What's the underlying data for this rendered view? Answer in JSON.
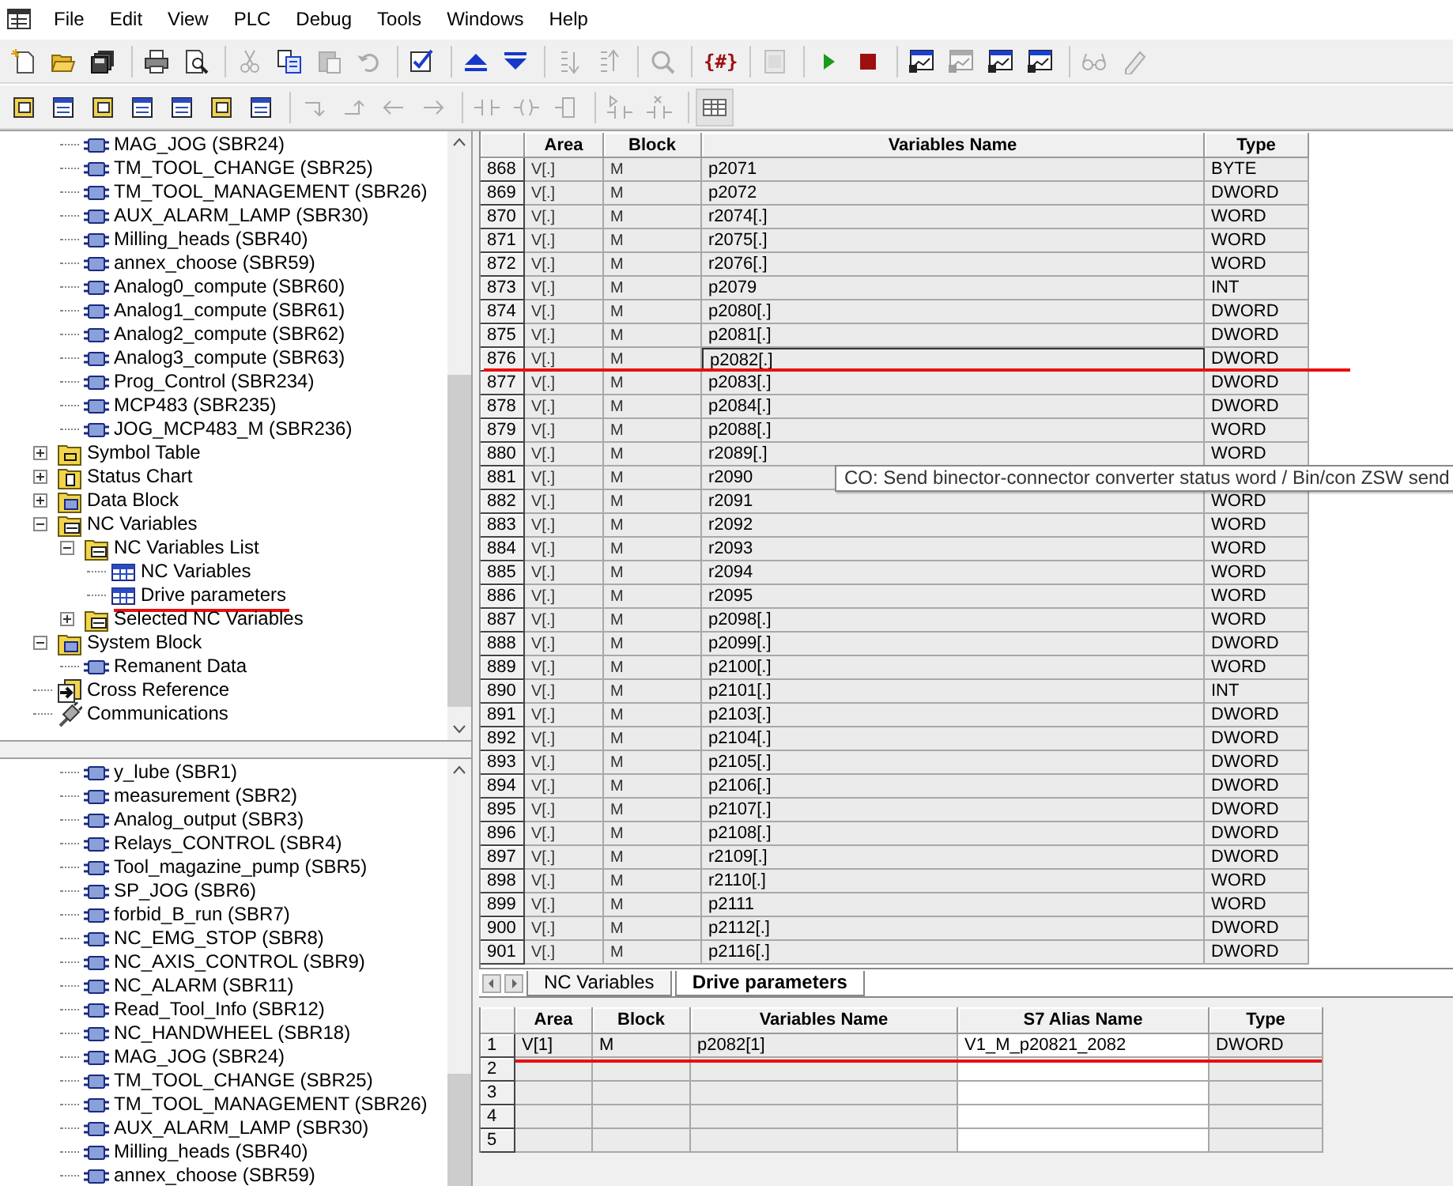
{
  "menu": [
    "File",
    "Edit",
    "View",
    "PLC",
    "Debug",
    "Tools",
    "Windows",
    "Help"
  ],
  "toolbar_1": [
    {
      "kind": "new",
      "disabled": false
    },
    {
      "kind": "open",
      "disabled": false
    },
    {
      "kind": "save-all",
      "disabled": false
    },
    {
      "kind": "separator"
    },
    {
      "kind": "print",
      "disabled": false
    },
    {
      "kind": "preview",
      "disabled": false
    },
    {
      "kind": "separator"
    },
    {
      "kind": "cut",
      "disabled": true
    },
    {
      "kind": "copy",
      "disabled": false
    },
    {
      "kind": "paste",
      "disabled": true
    },
    {
      "kind": "undo",
      "disabled": true
    },
    {
      "kind": "separator"
    },
    {
      "kind": "compile",
      "disabled": false
    },
    {
      "kind": "separator"
    },
    {
      "kind": "upload",
      "disabled": false
    },
    {
      "kind": "download",
      "disabled": false
    },
    {
      "kind": "separator"
    },
    {
      "kind": "sort-up",
      "disabled": true
    },
    {
      "kind": "sort-down",
      "disabled": true
    },
    {
      "kind": "separator"
    },
    {
      "kind": "find",
      "disabled": true
    },
    {
      "kind": "separator"
    },
    {
      "kind": "symbols",
      "text": "{#}",
      "disabled": false
    },
    {
      "kind": "separator"
    },
    {
      "kind": "window",
      "disabled": true
    },
    {
      "kind": "separator"
    },
    {
      "kind": "run",
      "disabled": false
    },
    {
      "kind": "stop",
      "disabled": false
    },
    {
      "kind": "separator"
    },
    {
      "kind": "monitor",
      "disabled": false
    },
    {
      "kind": "monitor",
      "disabled": true
    },
    {
      "kind": "monitor",
      "disabled": false
    },
    {
      "kind": "monitor",
      "disabled": false
    },
    {
      "kind": "separator"
    },
    {
      "kind": "glasses",
      "disabled": true
    },
    {
      "kind": "pen",
      "disabled": true
    }
  ],
  "toolbar_2": [
    {
      "kind": "doc-yellow",
      "disabled": false,
      "pressed": false
    },
    {
      "kind": "doc-blue",
      "disabled": false,
      "pressed": false
    },
    {
      "kind": "doc-yellow",
      "disabled": false,
      "pressed": false
    },
    {
      "kind": "doc-blue",
      "disabled": false,
      "pressed": false
    },
    {
      "kind": "doc-blue",
      "disabled": false,
      "pressed": false
    },
    {
      "kind": "doc-yellow",
      "disabled": false,
      "pressed": false
    },
    {
      "kind": "doc-blue",
      "disabled": false,
      "pressed": false
    },
    {
      "kind": "separator"
    },
    {
      "kind": "arrow-down-right",
      "disabled": true,
      "pressed": false
    },
    {
      "kind": "arrow-up-right",
      "disabled": true,
      "pressed": false
    },
    {
      "kind": "arrow-left",
      "disabled": true,
      "pressed": false
    },
    {
      "kind": "arrow-right",
      "disabled": true,
      "pressed": false
    },
    {
      "kind": "separator"
    },
    {
      "kind": "contact",
      "disabled": true,
      "pressed": false
    },
    {
      "kind": "coil",
      "disabled": true,
      "pressed": false
    },
    {
      "kind": "box",
      "disabled": true,
      "pressed": false
    },
    {
      "kind": "separator"
    },
    {
      "kind": "contact-arrow",
      "disabled": true,
      "pressed": false
    },
    {
      "kind": "contact-x",
      "disabled": true,
      "pressed": false
    },
    {
      "kind": "separator"
    },
    {
      "kind": "grid",
      "disabled": false,
      "pressed": true
    }
  ],
  "top_tree": {
    "scrolled_children": [
      "MAG_JOG (SBR24)",
      "TM_TOOL_CHANGE (SBR25)",
      "TM_TOOL_MANAGEMENT (SBR26)",
      "AUX_ALARM_LAMP (SBR30)",
      "Milling_heads (SBR40)",
      "annex_choose (SBR59)",
      "Analog0_compute (SBR60)",
      "Analog1_compute (SBR61)",
      "Analog2_compute (SBR62)",
      "Analog3_compute (SBR63)",
      "Prog_Control (SBR234)",
      "MCP483 (SBR235)",
      "JOG_MCP483_M (SBR236)"
    ],
    "nodes": [
      {
        "label": "Symbol Table",
        "kind": "symbol-table",
        "expanded": false
      },
      {
        "label": "Status Chart",
        "kind": "status-chart",
        "expanded": false
      },
      {
        "label": "Data Block",
        "kind": "data-block",
        "expanded": false
      },
      {
        "label": "NC Variables",
        "kind": "nc-variables",
        "expanded": true,
        "children": [
          {
            "label": "NC Variables List",
            "kind": "nc-variables",
            "expanded": true,
            "children": [
              {
                "label": "NC Variables",
                "kind": "table",
                "underlined": false
              },
              {
                "label": "Drive parameters",
                "kind": "table",
                "underlined": true
              }
            ]
          },
          {
            "label": "Selected NC Variables",
            "kind": "nc-variables",
            "expanded": false
          }
        ]
      },
      {
        "label": "System Block",
        "kind": "data-block",
        "expanded": true,
        "children": [
          {
            "label": "Remanent Data",
            "kind": "subroutine"
          }
        ]
      },
      {
        "label": "Cross Reference",
        "kind": "cross-reference"
      },
      {
        "label": "Communications",
        "kind": "communications"
      }
    ]
  },
  "bottom_tree": {
    "scrolled_children": [
      "y_lube (SBR1)",
      "measurement (SBR2)",
      "Analog_output (SBR3)",
      "Relays_CONTROL (SBR4)",
      "Tool_magazine_pump (SBR5)",
      "SP_JOG (SBR6)",
      "forbid_B_run (SBR7)",
      "NC_EMG_STOP (SBR8)",
      "NC_AXIS_CONTROL (SBR9)",
      "NC_ALARM (SBR11)",
      "Read_Tool_Info (SBR12)",
      "NC_HANDWHEEL (SBR18)",
      "MAG_JOG (SBR24)",
      "TM_TOOL_CHANGE (SBR25)",
      "TM_TOOL_MANAGEMENT (SBR26)",
      "AUX_ALARM_LAMP (SBR30)",
      "Milling_heads (SBR40)",
      "annex_choose (SBR59)"
    ]
  },
  "table": {
    "columns": [
      "Area",
      "Block",
      "Variables Name",
      "Type"
    ],
    "rows": [
      {
        "number": "868",
        "cells": [
          "V[.]",
          "M",
          "p2071",
          "BYTE"
        ],
        "focused": false,
        "underlined": false
      },
      {
        "number": "869",
        "cells": [
          "V[.]",
          "M",
          "p2072",
          "DWORD"
        ],
        "focused": false,
        "underlined": false
      },
      {
        "number": "870",
        "cells": [
          "V[.]",
          "M",
          "r2074[.]",
          "WORD"
        ],
        "focused": false,
        "underlined": false
      },
      {
        "number": "871",
        "cells": [
          "V[.]",
          "M",
          "r2075[.]",
          "WORD"
        ],
        "focused": false,
        "underlined": false
      },
      {
        "number": "872",
        "cells": [
          "V[.]",
          "M",
          "r2076[.]",
          "WORD"
        ],
        "focused": false,
        "underlined": false
      },
      {
        "number": "873",
        "cells": [
          "V[.]",
          "M",
          "p2079",
          "INT"
        ],
        "focused": false,
        "underlined": false
      },
      {
        "number": "874",
        "cells": [
          "V[.]",
          "M",
          "p2080[.]",
          "DWORD"
        ],
        "focused": false,
        "underlined": false
      },
      {
        "number": "875",
        "cells": [
          "V[.]",
          "M",
          "p2081[.]",
          "DWORD"
        ],
        "focused": false,
        "underlined": false
      },
      {
        "number": "876",
        "cells": [
          "V[.]",
          "M",
          "p2082[.]",
          "DWORD"
        ],
        "focused": true,
        "underlined": true
      },
      {
        "number": "877",
        "cells": [
          "V[.]",
          "M",
          "p2083[.]",
          "DWORD"
        ],
        "focused": false,
        "underlined": false
      },
      {
        "number": "878",
        "cells": [
          "V[.]",
          "M",
          "p2084[.]",
          "DWORD"
        ],
        "focused": false,
        "underlined": false
      },
      {
        "number": "879",
        "cells": [
          "V[.]",
          "M",
          "p2088[.]",
          "WORD"
        ],
        "focused": false,
        "underlined": false
      },
      {
        "number": "880",
        "cells": [
          "V[.]",
          "M",
          "r2089[.]",
          "WORD"
        ],
        "focused": false,
        "underlined": false
      },
      {
        "number": "881",
        "cells": [
          "V[.]",
          "M",
          "r2090",
          null
        ],
        "focused": false,
        "underlined": false
      },
      {
        "number": "882",
        "cells": [
          "V[.]",
          "M",
          "r2091",
          "WORD"
        ],
        "focused": false,
        "underlined": false
      },
      {
        "number": "883",
        "cells": [
          "V[.]",
          "M",
          "r2092",
          "WORD"
        ],
        "focused": false,
        "underlined": false
      },
      {
        "number": "884",
        "cells": [
          "V[.]",
          "M",
          "r2093",
          "WORD"
        ],
        "focused": false,
        "underlined": false
      },
      {
        "number": "885",
        "cells": [
          "V[.]",
          "M",
          "r2094",
          "WORD"
        ],
        "focused": false,
        "underlined": false
      },
      {
        "number": "886",
        "cells": [
          "V[.]",
          "M",
          "r2095",
          "WORD"
        ],
        "focused": false,
        "underlined": false
      },
      {
        "number": "887",
        "cells": [
          "V[.]",
          "M",
          "p2098[.]",
          "WORD"
        ],
        "focused": false,
        "underlined": false
      },
      {
        "number": "888",
        "cells": [
          "V[.]",
          "M",
          "p2099[.]",
          "DWORD"
        ],
        "focused": false,
        "underlined": false
      },
      {
        "number": "889",
        "cells": [
          "V[.]",
          "M",
          "p2100[.]",
          "WORD"
        ],
        "focused": false,
        "underlined": false
      },
      {
        "number": "890",
        "cells": [
          "V[.]",
          "M",
          "p2101[.]",
          "INT"
        ],
        "focused": false,
        "underlined": false
      },
      {
        "number": "891",
        "cells": [
          "V[.]",
          "M",
          "p2103[.]",
          "DWORD"
        ],
        "focused": false,
        "underlined": false
      },
      {
        "number": "892",
        "cells": [
          "V[.]",
          "M",
          "p2104[.]",
          "DWORD"
        ],
        "focused": false,
        "underlined": false
      },
      {
        "number": "893",
        "cells": [
          "V[.]",
          "M",
          "p2105[.]",
          "DWORD"
        ],
        "focused": false,
        "underlined": false
      },
      {
        "number": "894",
        "cells": [
          "V[.]",
          "M",
          "p2106[.]",
          "DWORD"
        ],
        "focused": false,
        "underlined": false
      },
      {
        "number": "895",
        "cells": [
          "V[.]",
          "M",
          "p2107[.]",
          "DWORD"
        ],
        "focused": false,
        "underlined": false
      },
      {
        "number": "896",
        "cells": [
          "V[.]",
          "M",
          "p2108[.]",
          "DWORD"
        ],
        "focused": false,
        "underlined": false
      },
      {
        "number": "897",
        "cells": [
          "V[.]",
          "M",
          "r2109[.]",
          "DWORD"
        ],
        "focused": false,
        "underlined": false
      },
      {
        "number": "898",
        "cells": [
          "V[.]",
          "M",
          "r2110[.]",
          "WORD"
        ],
        "focused": false,
        "underlined": false
      },
      {
        "number": "899",
        "cells": [
          "V[.]",
          "M",
          "p2111",
          "WORD"
        ],
        "focused": false,
        "underlined": false
      },
      {
        "number": "900",
        "cells": [
          "V[.]",
          "M",
          "p2112[.]",
          "DWORD"
        ],
        "focused": false,
        "underlined": false
      },
      {
        "number": "901",
        "cells": [
          "V[.]",
          "M",
          "p2116[.]",
          "DWORD"
        ],
        "focused": false,
        "underlined": false
      }
    ]
  },
  "tooltip": "CO: Send binector-connector converter status word / Bin/con ZSW send",
  "sheet_tabs": [
    {
      "label": "NC Variables",
      "selected": false
    },
    {
      "label": "Drive parameters",
      "selected": true
    }
  ],
  "selected_table": {
    "columns": [
      "Area",
      "Block",
      "Variables Name",
      "S7 Alias Name",
      "Type"
    ],
    "rows": [
      {
        "number": "1",
        "cells": [
          "V[1]",
          "M",
          "p2082[1]",
          "V1_M_p20821_2082",
          "DWORD"
        ],
        "underlined": true
      },
      {
        "number": "2",
        "underlined": false
      },
      {
        "number": "3",
        "underlined": false
      },
      {
        "number": "4",
        "underlined": false
      },
      {
        "number": "5",
        "underlined": false
      }
    ]
  }
}
